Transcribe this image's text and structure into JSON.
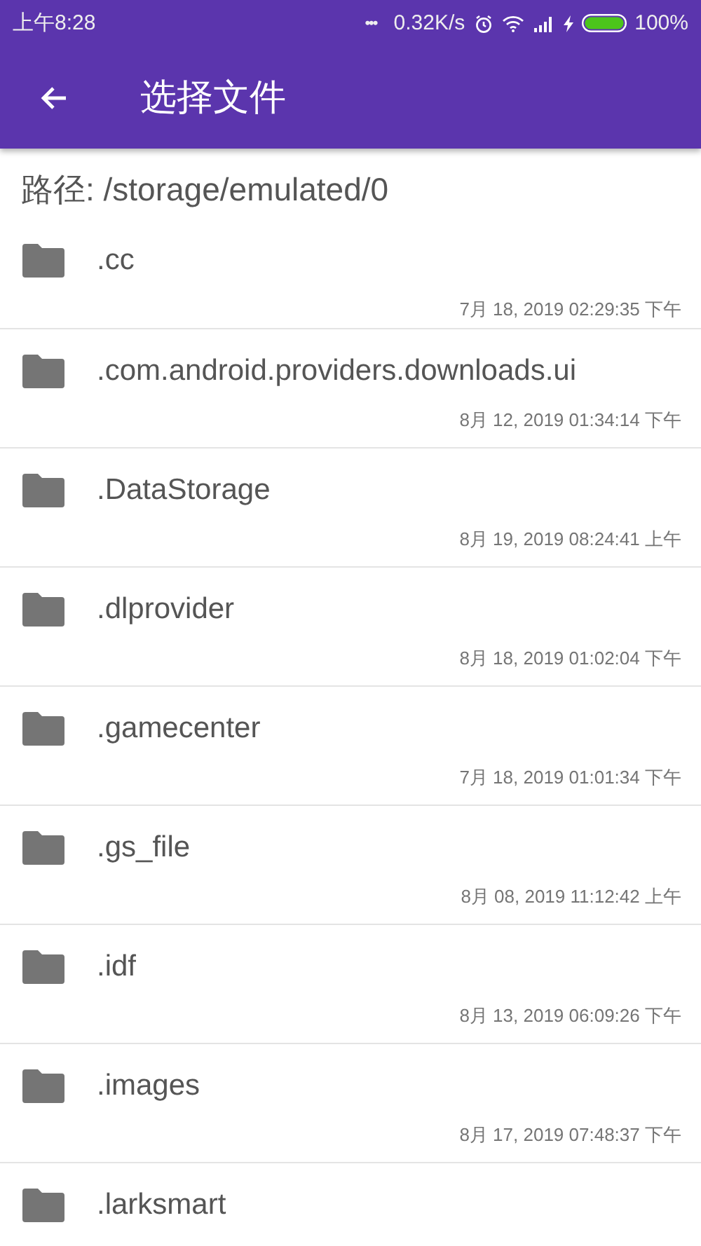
{
  "status_bar": {
    "time": "上午8:28",
    "more": "•••",
    "speed": "0.32K/s",
    "battery": "100%"
  },
  "toolbar": {
    "title": "选择文件"
  },
  "path": "路径: /storage/emulated/0",
  "files": [
    {
      "name": ".cc",
      "date": "7月 18, 2019 02:29:35 下午"
    },
    {
      "name": ".com.android.providers.downloads.ui",
      "date": "8月 12, 2019 01:34:14 下午"
    },
    {
      "name": ".DataStorage",
      "date": "8月 19, 2019 08:24:41 上午"
    },
    {
      "name": ".dlprovider",
      "date": "8月 18, 2019 01:02:04 下午"
    },
    {
      "name": ".gamecenter",
      "date": "7月 18, 2019 01:01:34 下午"
    },
    {
      "name": ".gs_file",
      "date": "8月 08, 2019 11:12:42 上午"
    },
    {
      "name": ".idf",
      "date": "8月 13, 2019 06:09:26 下午"
    },
    {
      "name": ".images",
      "date": "8月 17, 2019 07:48:37 下午"
    },
    {
      "name": ".larksmart"
    }
  ]
}
